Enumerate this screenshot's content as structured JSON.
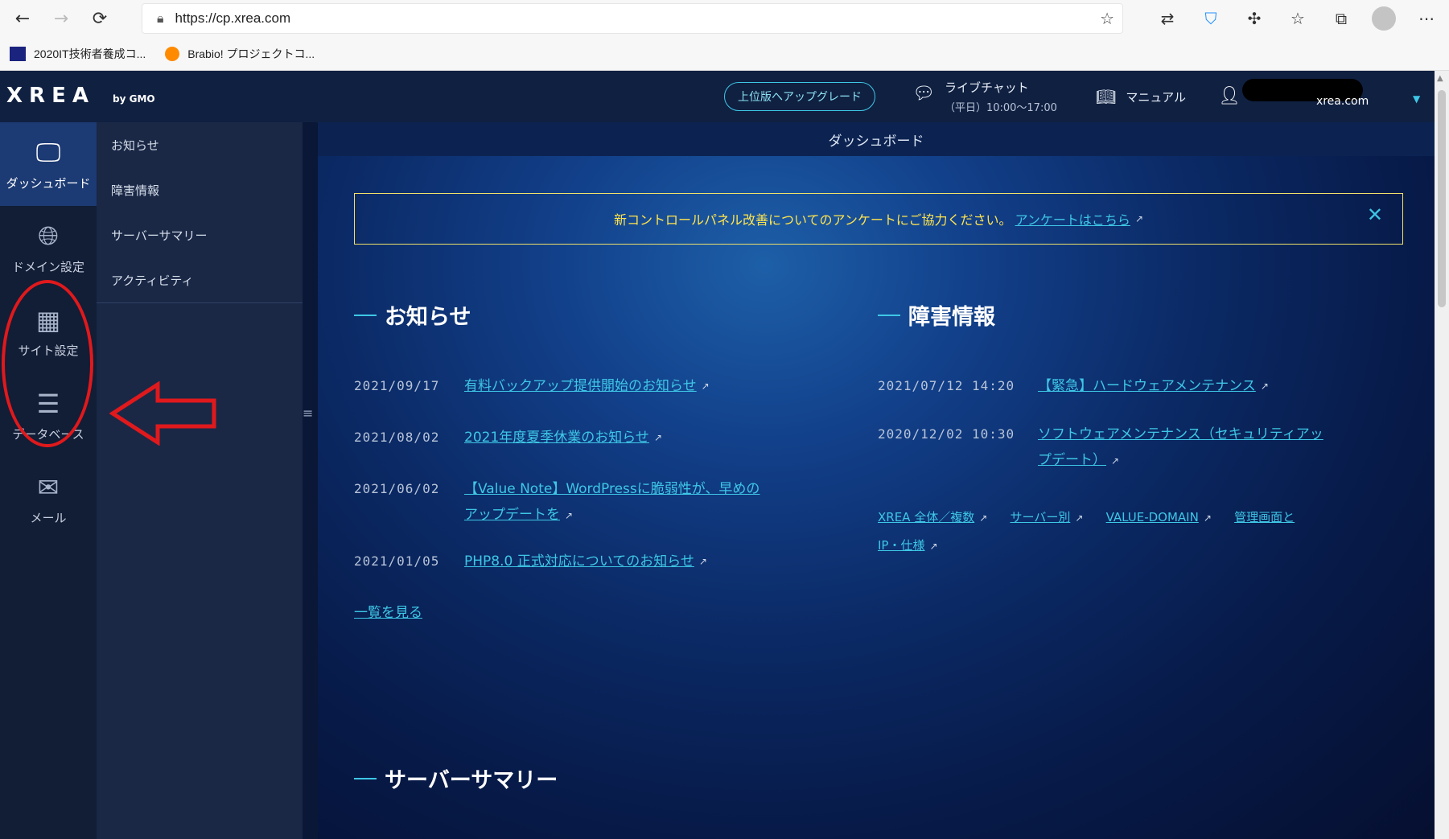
{
  "browser": {
    "url": "https://cp.xrea.com",
    "bookmarks": [
      {
        "label": "2020IT技術者養成コ..."
      },
      {
        "label": "Brabio! プロジェクトコ..."
      }
    ]
  },
  "header": {
    "upgrade_label": "上位版へアップグレード",
    "chat_label": "ライブチャット",
    "chat_hours": "（平日）10:00～17:00",
    "manual_label": "マニュアル",
    "account_domain": "xrea.com"
  },
  "sidebar": {
    "items": [
      {
        "label": "ダッシュボード",
        "icon": "monitor-icon"
      },
      {
        "label": "ドメイン設定",
        "icon": "www-globe-icon"
      },
      {
        "label": "サイト設定",
        "icon": "grid-plus-icon"
      },
      {
        "label": "データベース",
        "icon": "database-icon"
      },
      {
        "label": "メール",
        "icon": "envelope-icon"
      }
    ]
  },
  "subnav": {
    "items": [
      {
        "label": "お知らせ"
      },
      {
        "label": "障害情報"
      },
      {
        "label": "サーバーサマリー"
      },
      {
        "label": "アクティビティ"
      }
    ]
  },
  "main": {
    "page_title": "ダッシュボード",
    "notice_text": "新コントロールパネル改善についてのアンケートにご協力ください。",
    "notice_link": "アンケートはこちら",
    "news": {
      "title": "お知らせ",
      "items": [
        {
          "date": "2021/09/17",
          "title": "有料バックアップ提供開始のお知らせ"
        },
        {
          "date": "2021/08/02",
          "title": "2021年度夏季休業のお知らせ"
        },
        {
          "date": "2021/06/02",
          "title_line1": "【Value Note】WordPressに脆弱性が、早めの",
          "title_line2": "アップデートを"
        },
        {
          "date": "2021/01/05",
          "title": "PHP8.0 正式対応についてのお知らせ"
        }
      ],
      "view_all": "一覧を見る"
    },
    "incidents": {
      "title": "障害情報",
      "items": [
        {
          "date": "2021/07/12 14:20",
          "title": "【緊急】ハードウェアメンテナンス"
        },
        {
          "date": "2020/12/02 10:30",
          "title_line1": "ソフトウェアメンテナンス（セキュリティアッ",
          "title_line2": "プデート）"
        }
      ],
      "links": [
        {
          "label": "XREA 全体／複数"
        },
        {
          "label": "サーバー別"
        },
        {
          "label": "VALUE-DOMAIN"
        },
        {
          "label": "管理画面と"
        },
        {
          "label": "IP・仕様"
        }
      ]
    },
    "server_summary_title": "サーバーサマリー"
  },
  "colors": {
    "accent": "#3ec7e6",
    "notice_text": "#ffe44d",
    "annotation": "#e0191c"
  }
}
